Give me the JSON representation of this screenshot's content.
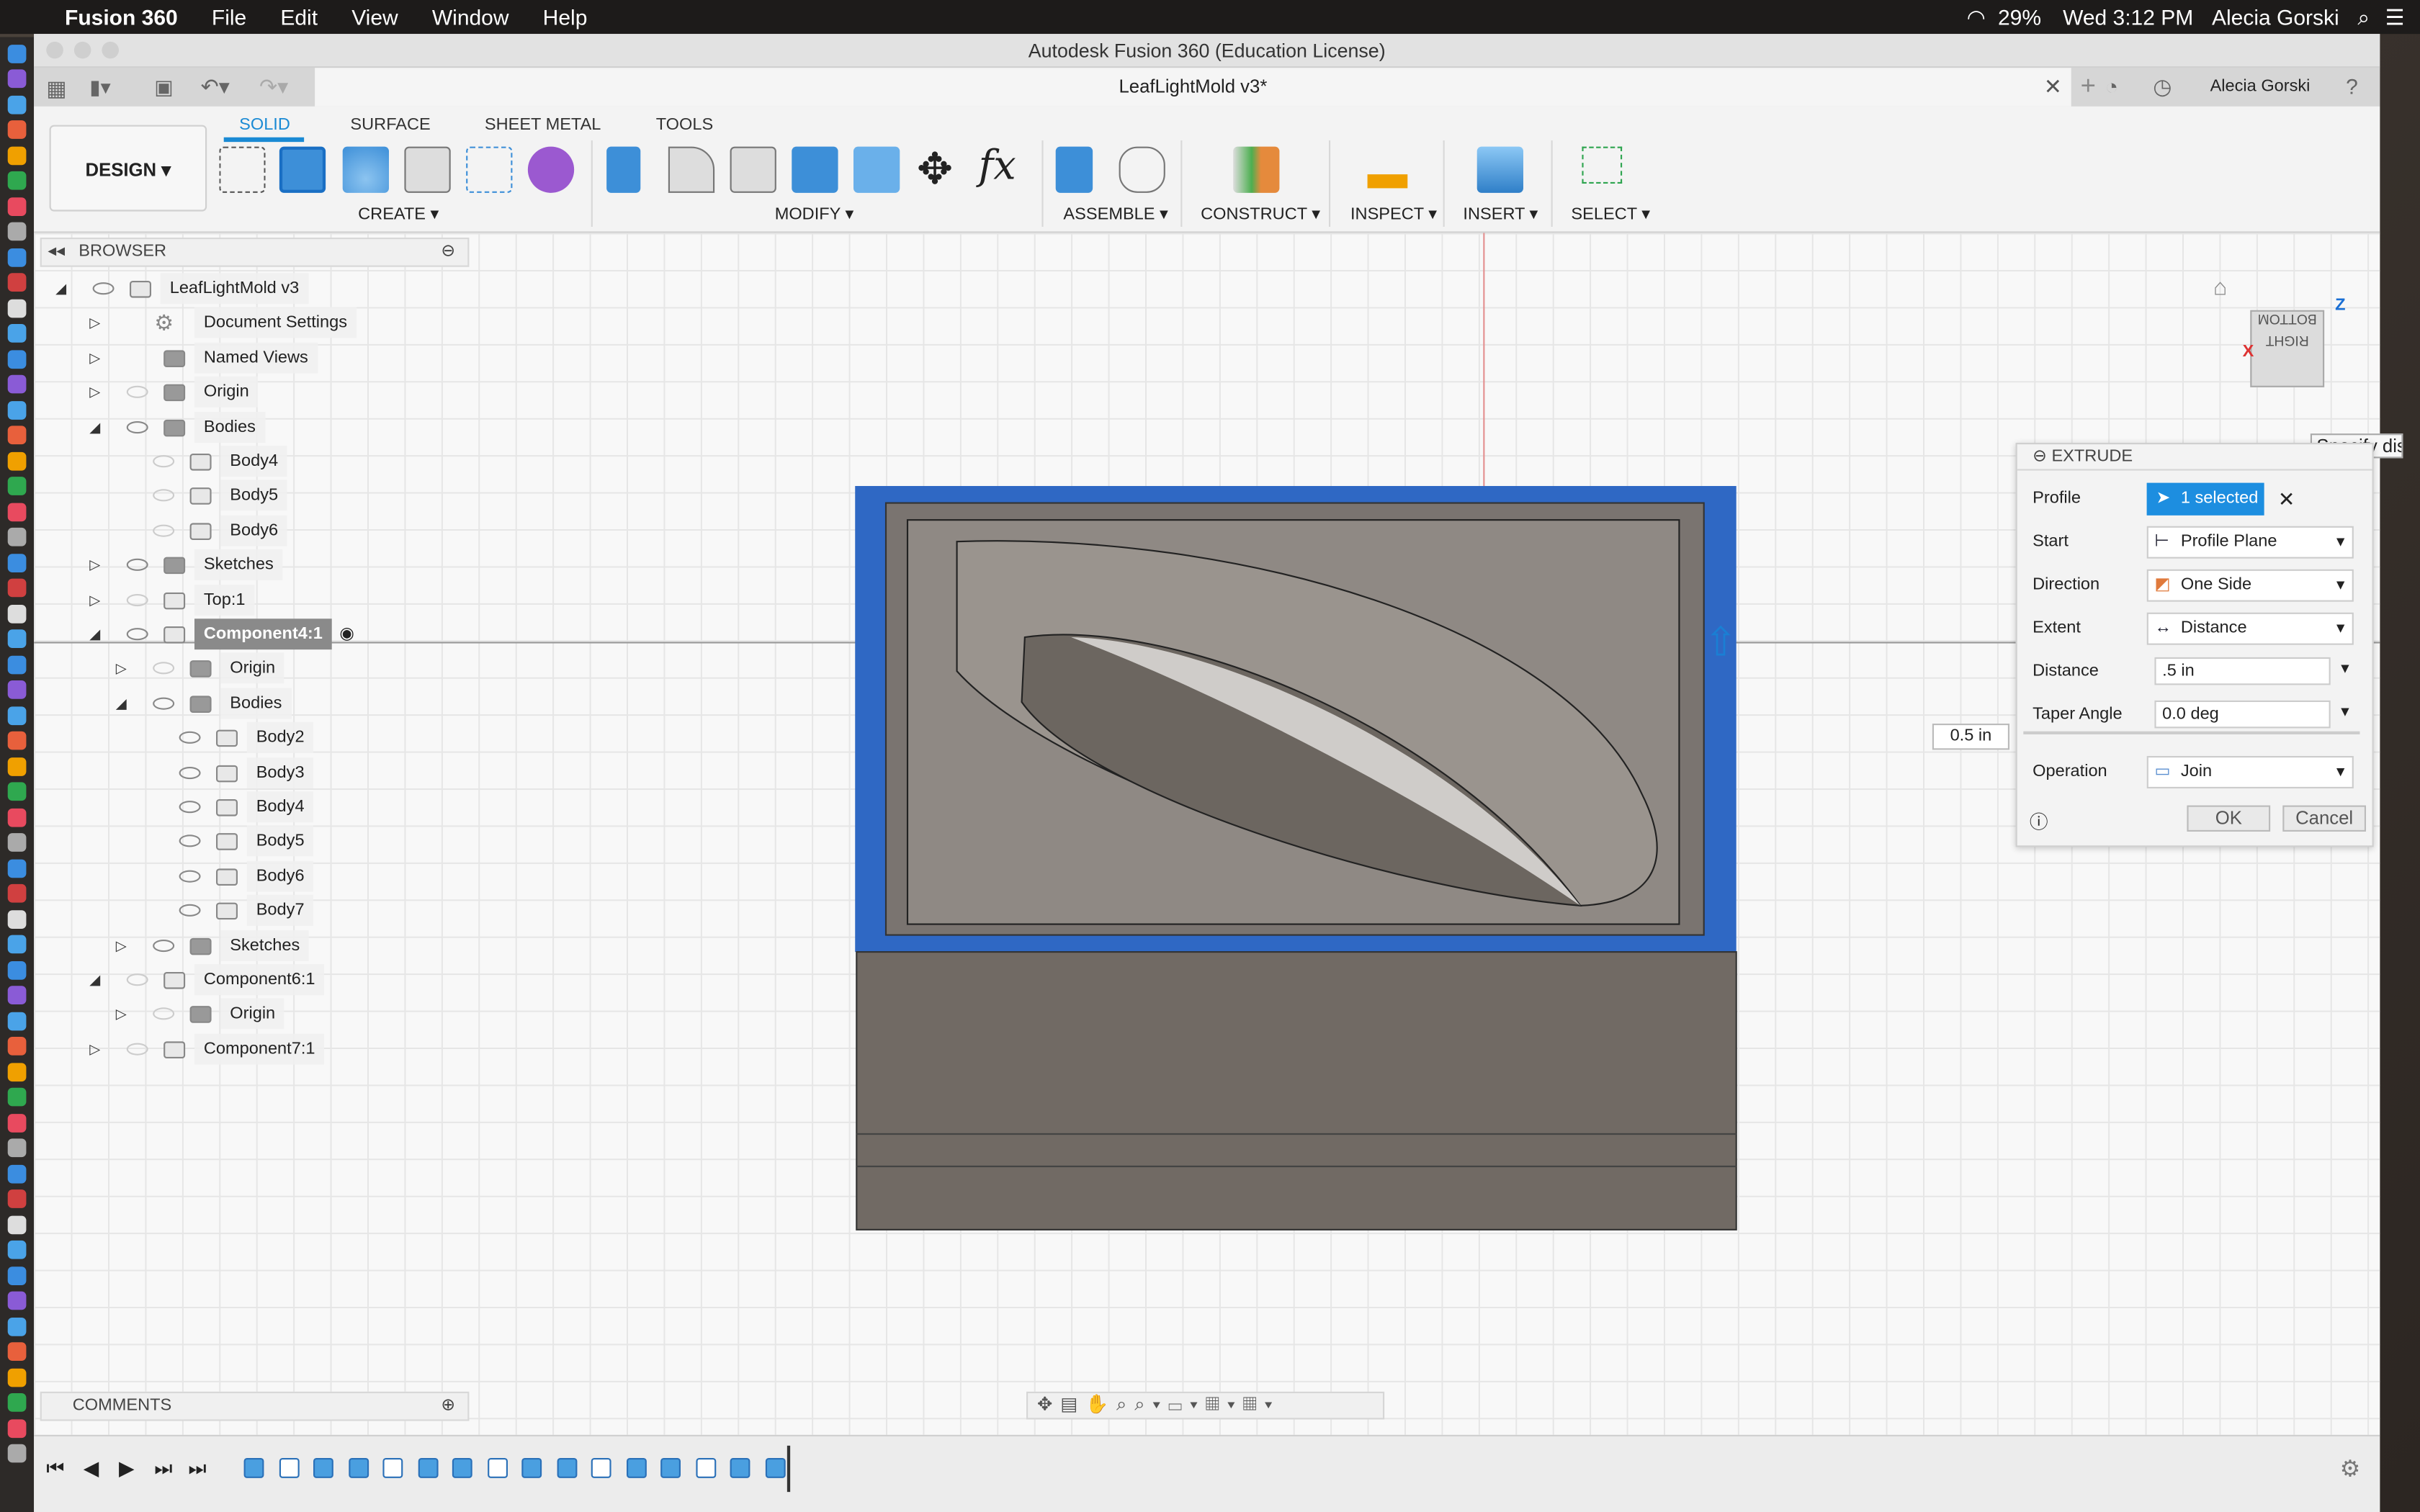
{
  "menubar": {
    "app": "Fusion 360",
    "items": [
      "File",
      "Edit",
      "View",
      "Window",
      "Help"
    ],
    "battery": "29%",
    "clock": "Wed 3:12 PM",
    "user": "Alecia Gorski"
  },
  "window": {
    "title": "Autodesk Fusion 360 (Education License)",
    "doc_tab": "LeafLightMold v3*",
    "user": "Alecia Gorski"
  },
  "ribbon": {
    "workspace": "DESIGN ▾",
    "tabs": [
      "SOLID",
      "SURFACE",
      "SHEET METAL",
      "TOOLS"
    ],
    "active_tab": "SOLID",
    "groups": [
      "CREATE ▾",
      "MODIFY ▾",
      "ASSEMBLE ▾",
      "CONSTRUCT ▾",
      "INSPECT ▾",
      "INSERT ▾",
      "SELECT ▾"
    ],
    "accent": "#1a8ad4"
  },
  "browser": {
    "title": "BROWSER",
    "nodes": [
      {
        "label": "LeafLightMold v3",
        "expanded": true,
        "visible": true,
        "icon": "document-icon"
      },
      {
        "label": "Document Settings",
        "expanded": false,
        "icon": "gear-icon"
      },
      {
        "label": "Named Views",
        "expanded": false,
        "icon": "folder-icon"
      },
      {
        "label": "Origin",
        "expanded": false,
        "visible": false,
        "icon": "folder-icon"
      },
      {
        "label": "Bodies",
        "expanded": true,
        "visible": true,
        "icon": "folder-icon"
      },
      {
        "label": "Body4",
        "visible": false,
        "icon": "body-icon"
      },
      {
        "label": "Body5",
        "visible": false,
        "icon": "body-icon"
      },
      {
        "label": "Body6",
        "visible": false,
        "icon": "body-icon"
      },
      {
        "label": "Sketches",
        "expanded": false,
        "visible": true,
        "icon": "folder-icon"
      },
      {
        "label": "Top:1",
        "expanded": false,
        "visible": false,
        "icon": "component-icon"
      },
      {
        "label": "Component4:1",
        "expanded": true,
        "visible": true,
        "active": true,
        "icon": "component-icon"
      },
      {
        "label": "Origin",
        "expanded": false,
        "visible": false,
        "icon": "folder-icon"
      },
      {
        "label": "Bodies",
        "expanded": true,
        "visible": true,
        "icon": "folder-icon"
      },
      {
        "label": "Body2",
        "visible": true,
        "icon": "body-icon"
      },
      {
        "label": "Body3",
        "visible": true,
        "icon": "body-icon"
      },
      {
        "label": "Body4",
        "visible": true,
        "icon": "body-icon"
      },
      {
        "label": "Body5",
        "visible": true,
        "icon": "body-icon"
      },
      {
        "label": "Body6",
        "visible": true,
        "icon": "body-icon"
      },
      {
        "label": "Body7",
        "visible": true,
        "icon": "body-icon"
      },
      {
        "label": "Sketches",
        "expanded": false,
        "visible": true,
        "icon": "folder-icon"
      },
      {
        "label": "Component6:1",
        "expanded": true,
        "visible": false,
        "icon": "component-icon"
      },
      {
        "label": "Origin",
        "expanded": false,
        "visible": false,
        "icon": "folder-icon"
      },
      {
        "label": "Component7:1",
        "expanded": false,
        "visible": false,
        "icon": "component-icon"
      }
    ]
  },
  "comments": {
    "title": "COMMENTS"
  },
  "viewport": {
    "dimension_value": "0.5 in",
    "tooltip": "Specify dista",
    "viewcube": {
      "face": "RIGHT",
      "top": "BOTTOM",
      "axis_z": "Z",
      "axis_x": "X"
    }
  },
  "extrude": {
    "title": "EXTRUDE",
    "fields": [
      {
        "label": "Profile",
        "value": "1 selected"
      },
      {
        "label": "Start",
        "value": "Profile Plane"
      },
      {
        "label": "Direction",
        "value": "One Side"
      },
      {
        "label": "Extent",
        "value": "Distance"
      },
      {
        "label": "Distance",
        "value": ".5 in"
      },
      {
        "label": "Taper Angle",
        "value": "0.0 deg"
      },
      {
        "label": "Operation",
        "value": "Join"
      }
    ],
    "ok": "OK",
    "cancel": "Cancel"
  }
}
